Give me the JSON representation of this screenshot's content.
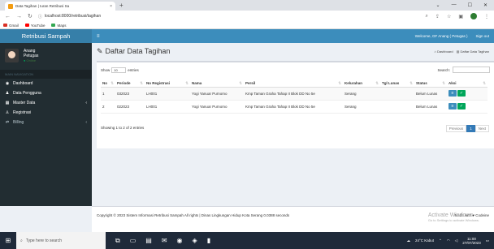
{
  "browser": {
    "tab_title": "Data Tagihan | Iuran Retribusi Sa",
    "tab_close": "×",
    "new_tab": "+",
    "url": "localhost:8000/retribusi/tagihan",
    "bookmarks": [
      {
        "label": "Gmail",
        "color": "#d93025"
      },
      {
        "label": "YouTube",
        "color": "#ff0000"
      },
      {
        "label": "Maps",
        "color": "#34a853"
      }
    ]
  },
  "app": {
    "logo": "Retribusi Sampah",
    "welcome": "Welcome, GF Anang ( Petugas )",
    "sign_out": "Sign out"
  },
  "sidebar": {
    "user_name": "Anang",
    "user_role": "Petugas",
    "status": "Online",
    "nav_header": "MAIN NAVIGATION",
    "items": [
      {
        "label": "Dashboard",
        "icon": "dashboard-icon"
      },
      {
        "label": "Data Pengguna",
        "icon": "user-icon"
      },
      {
        "label": "Master Data",
        "icon": "table-icon"
      },
      {
        "label": "Registrasi",
        "icon": "user-plus-icon"
      },
      {
        "label": "Billing",
        "icon": "exchange-icon"
      }
    ]
  },
  "page": {
    "title": "Daftar Data Tagihan",
    "breadcrumb": [
      "Dashboard",
      "Daftar Data Tagihan"
    ]
  },
  "table_tools": {
    "show": "Show",
    "entries_value": "10",
    "entries": "entries",
    "search": "Search:"
  },
  "table": {
    "headers": [
      "No",
      "Periode",
      "No Registrasi",
      "Nama",
      "Persil",
      "Kelurahan",
      "Tgl Lunas",
      "Status",
      "Aksi"
    ],
    "rows": [
      [
        "1",
        "032023",
        "LH001",
        "Yogi Yanuar Purnomo",
        "Kmp Taman Graha Tahap II Blok DD No 5e",
        "Serang",
        "",
        "Belum Lunas"
      ],
      [
        "2",
        "022023",
        "LH001",
        "Yogi Yanuar Purnomo",
        "Kmp Taman Graha Tahap II Blok DD No 5e",
        "Serang",
        "",
        "Belum Lunas"
      ]
    ],
    "showing": "Showing 1 to 2 of 2 entries",
    "pager": {
      "prev": "Previous",
      "page": "1",
      "next": "Next"
    }
  },
  "footer": {
    "copyright": "Copyright © 2023 Sistem Informasi Retribusi Sampah All rights | Dinas Lingkungan Hidup Kota Serang 0.0388 seconds",
    "made": "Made with ♥ Codeine"
  },
  "watermark": {
    "title": "Activate Windows",
    "sub": "Go to Settings to activate Windows."
  },
  "taskbar": {
    "search_placeholder": "Type here to search",
    "weather": "24°C Kabut",
    "time": "11:00",
    "date": "27/07/2023"
  }
}
